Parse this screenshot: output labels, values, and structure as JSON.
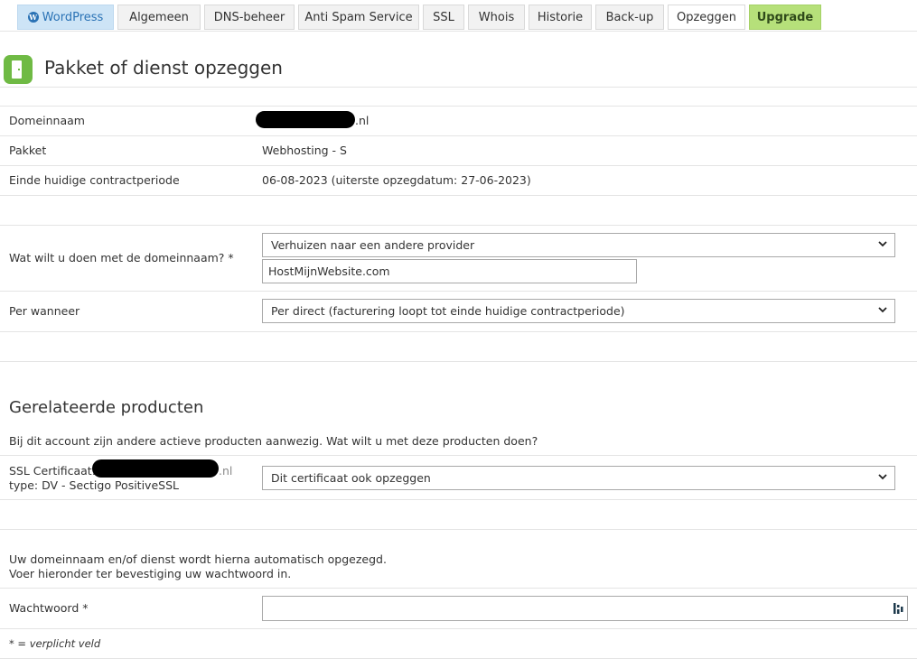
{
  "tabs": [
    {
      "label": "WordPress"
    },
    {
      "label": "Algemeen"
    },
    {
      "label": "DNS-beheer"
    },
    {
      "label": "Anti Spam Service"
    },
    {
      "label": "SSL"
    },
    {
      "label": "Whois"
    },
    {
      "label": "Historie"
    },
    {
      "label": "Back-up"
    },
    {
      "label": "Opzeggen"
    },
    {
      "label": "Upgrade"
    }
  ],
  "page_title": "Pakket of dienst opzeggen",
  "details": {
    "domain_label": "Domeinnaam",
    "domain_suffix": ".nl",
    "package_label": "Pakket",
    "package_value": "Webhosting - S",
    "contract_label": "Einde huidige contractperiode",
    "contract_value": "06-08-2023 (uiterste opzegdatum: 27-06-2023)"
  },
  "form": {
    "domain_action_label": "Wat wilt u doen met de domeinnaam? *",
    "domain_action_value": "Verhuizen naar een andere provider",
    "provider_value": "HostMijnWebsite.com",
    "when_label": "Per wanneer",
    "when_value": "Per direct (facturering loopt tot einde huidige contractperiode)"
  },
  "related": {
    "heading": "Gerelateerde producten",
    "intro": "Bij dit account zijn andere actieve producten aanwezig. Wat wilt u met deze producten doen?",
    "ssl_label": "SSL Certificaat:",
    "ssl_suffix": ".nl",
    "ssl_type": "type: DV - Sectigo PositiveSSL",
    "ssl_action_value": "Dit certificaat ook opzeggen"
  },
  "confirm": {
    "line1": "Uw domeinnaam en/of dienst wordt hierna automatisch opgezegd.",
    "line2": "Voer hieronder ter bevestiging uw wachtwoord in.",
    "password_label": "Wachtwoord *",
    "required_note": "* = verplicht veld"
  },
  "colors": {
    "wordpress_tab": "#cde4f6",
    "upgrade_tab": "#b6e07a",
    "icon_green": "#6fba44"
  }
}
